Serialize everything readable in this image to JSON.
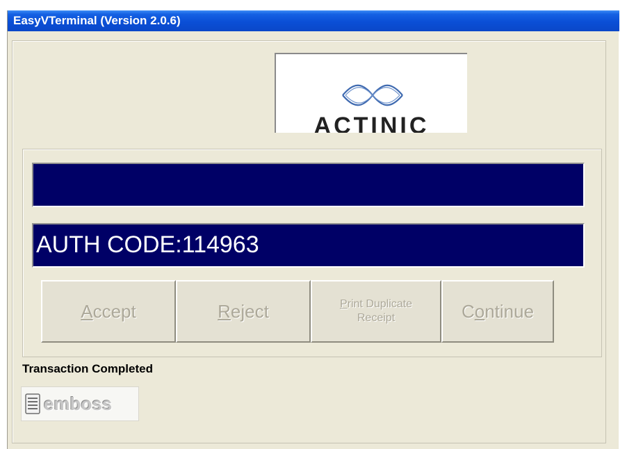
{
  "window": {
    "title": "EasyVTerminal (Version 2.0.6)"
  },
  "logo": {
    "text": "ACTINIC",
    "icon": "actinic-wave-logo"
  },
  "display": {
    "line1": "",
    "line2": "AUTH CODE:114963"
  },
  "buttons": {
    "accept": {
      "label": "Accept",
      "mnemonic": "A",
      "enabled": false
    },
    "reject": {
      "label": "Reject",
      "mnemonic": "R",
      "enabled": false
    },
    "print_duplicate": {
      "line1": "Print Duplicate",
      "line2": "Receipt",
      "mnemonic": "P",
      "enabled": false
    },
    "continue": {
      "label": "Continue",
      "mnemonic": "o",
      "enabled": false
    }
  },
  "status": {
    "text": "Transaction Completed"
  },
  "branding": {
    "text": "emboss",
    "icon": "emboss-stack-icon"
  },
  "colors": {
    "titlebar": "#0a4fd6",
    "display_bg": "#000066",
    "display_text": "#ffffff",
    "window_bg": "#ece9d8",
    "disabled_text": "#aca899"
  }
}
